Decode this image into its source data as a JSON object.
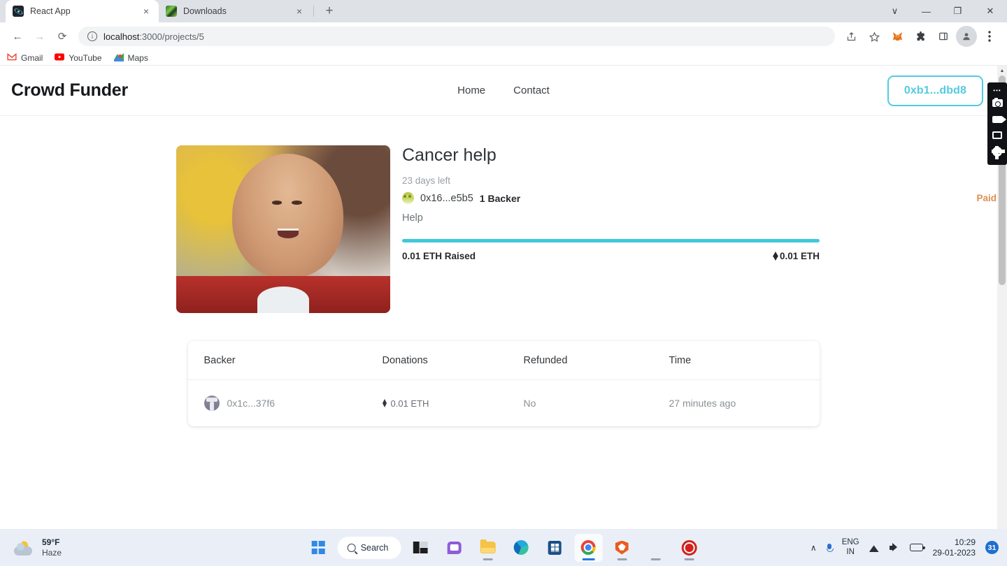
{
  "browser": {
    "tabs": [
      {
        "title": "React App",
        "favicon": "react-icon",
        "active": true
      },
      {
        "title": "Downloads",
        "favicon": "downloads-icon",
        "active": false
      }
    ],
    "new_tab_label": "+",
    "close_label": "×",
    "window_controls": {
      "minimize_all": "∨",
      "minimize": "—",
      "maximize": "❐",
      "close": "✕"
    },
    "nav": {
      "back": "←",
      "forward": "→",
      "reload": "⟳"
    },
    "omnibox": {
      "info_glyph": "i",
      "url_host": "localhost",
      "url_path": ":3000/projects/5",
      "full_url": "localhost:3000/projects/5"
    },
    "toolbar_icons": [
      "share-icon",
      "bookmark-star-icon",
      "metamask-icon",
      "extensions-icon",
      "side-panel-icon",
      "profile-avatar",
      "chrome-menu-icon"
    ],
    "bookmarks": [
      {
        "label": "Gmail",
        "icon": "gmail-icon"
      },
      {
        "label": "YouTube",
        "icon": "youtube-icon"
      },
      {
        "label": "Maps",
        "icon": "maps-icon"
      }
    ]
  },
  "site": {
    "brand": "Crowd Funder",
    "nav": [
      {
        "label": "Home"
      },
      {
        "label": "Contact"
      }
    ],
    "wallet_button": "0xb1...dbd8",
    "accent_color": "#53cbe0"
  },
  "project": {
    "title": "Cancer help",
    "days_left": "23 days left",
    "owner_address": "0x16...e5b5",
    "backers_label": "1 Backer",
    "status": "Paid",
    "status_color": "#dd8f4e",
    "description": "Help",
    "progress_percent": 100,
    "raised_label": "0.01 ETH Raised",
    "target_amount": "0.01 ETH",
    "image_alt": "smiling-child-photo"
  },
  "table": {
    "columns": [
      "Backer",
      "Donations",
      "Refunded",
      "Time"
    ],
    "rows": [
      {
        "backer": "0x1c...37f6",
        "donation": "0.01 ETH",
        "refunded": "No",
        "time": "27 minutes ago"
      }
    ]
  },
  "recorder": {
    "items": [
      "camera-icon",
      "video-icon",
      "window-icon",
      "settings-gear-icon"
    ]
  },
  "taskbar": {
    "weather": {
      "temp": "59°F",
      "condition": "Haze"
    },
    "search_label": "Search",
    "apps": [
      {
        "name": "start-button"
      },
      {
        "name": "search-pill"
      },
      {
        "name": "task-view"
      },
      {
        "name": "chat"
      },
      {
        "name": "file-explorer"
      },
      {
        "name": "edge"
      },
      {
        "name": "microsoft-store"
      },
      {
        "name": "chrome"
      },
      {
        "name": "brave"
      },
      {
        "name": "screen-recorder"
      }
    ],
    "tray": {
      "chevron": "∧",
      "language_line1": "ENG",
      "language_line2": "IN",
      "time": "10:29",
      "date": "29-01-2023",
      "notification_count": "31"
    }
  }
}
